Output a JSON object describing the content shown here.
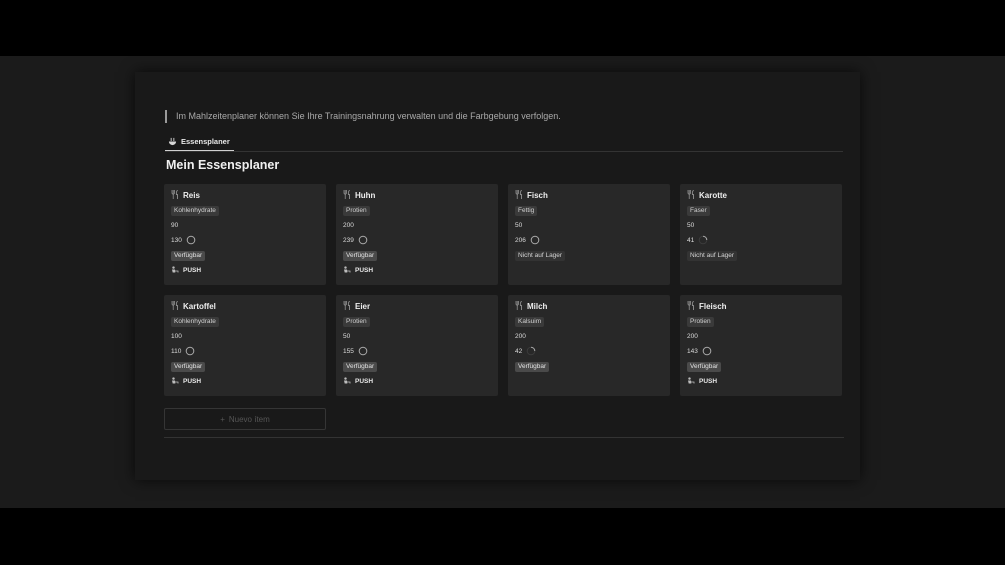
{
  "header": {
    "description": "Im Mahlzeitenplaner können Sie Ihre Trainingsnahrung verwalten und die Farbgebung verfolgen."
  },
  "tabs": [
    {
      "label": "Essensplaner",
      "icon": "utensils-bowl-icon",
      "active": true
    }
  ],
  "page_title": "Mein Essensplaner",
  "cards": [
    {
      "name": "Reis",
      "category": "Kohlenhydrate",
      "amount": "90",
      "calories": "130",
      "progress": 1.0,
      "status": "Verfügbar",
      "push": "PUSH"
    },
    {
      "name": "Huhn",
      "category": "Protien",
      "amount": "200",
      "calories": "239",
      "progress": 1.0,
      "status": "Verfügbar",
      "push": "PUSH"
    },
    {
      "name": "Fisch",
      "category": "Fettig",
      "amount": "50",
      "calories": "206",
      "progress": 1.0,
      "status": "Nicht auf Lager",
      "push": ""
    },
    {
      "name": "Karotte",
      "category": "Faser",
      "amount": "50",
      "calories": "41",
      "progress": 0.25,
      "status": "Nicht auf Lager",
      "push": ""
    },
    {
      "name": "Kartoffel",
      "category": "Kohlenhydrate",
      "amount": "100",
      "calories": "110",
      "progress": 1.0,
      "status": "Verfügbar",
      "push": "PUSH"
    },
    {
      "name": "Eier",
      "category": "Protien",
      "amount": "50",
      "calories": "155",
      "progress": 1.0,
      "status": "Verfügbar",
      "push": "PUSH"
    },
    {
      "name": "Milch",
      "category": "Kalsuim",
      "amount": "200",
      "calories": "42",
      "progress": 0.25,
      "status": "Verfügbar",
      "push": ""
    },
    {
      "name": "Fleisch",
      "category": "Protien",
      "amount": "200",
      "calories": "143",
      "progress": 1.0,
      "status": "Verfügbar",
      "push": "PUSH"
    }
  ],
  "new_item": {
    "icon": "plus-icon",
    "label": "Nuevo ítem"
  },
  "colors": {
    "background": "#191919",
    "card": "#282828",
    "text": "#e6e6e6",
    "muted": "#a9a9a9"
  }
}
